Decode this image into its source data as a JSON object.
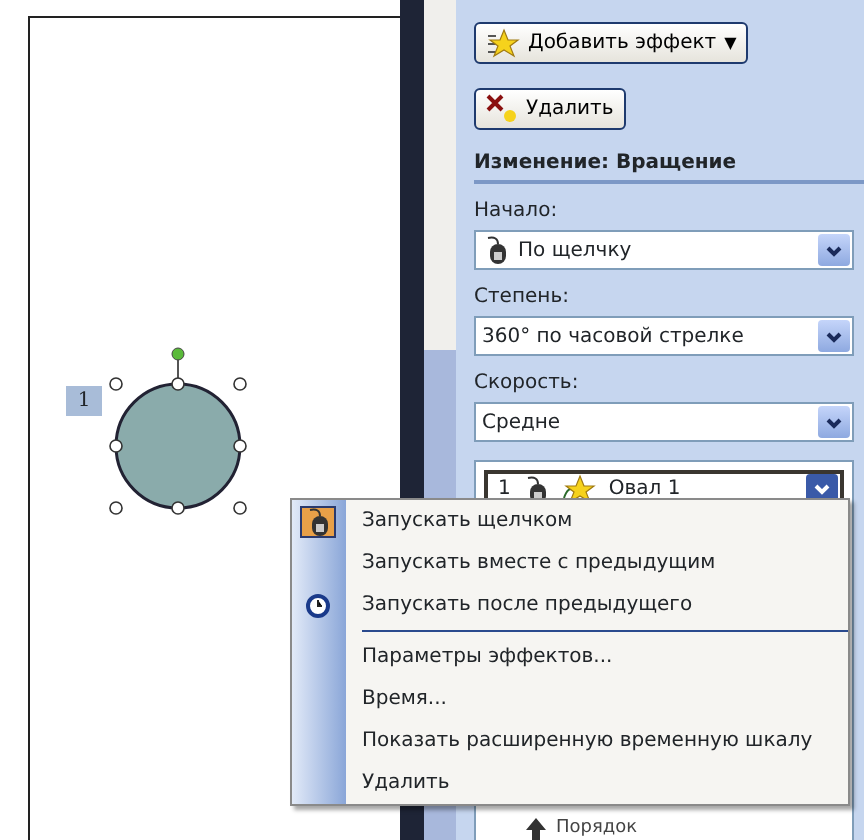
{
  "slide": {
    "shape": {
      "tag": "1",
      "selected": true
    }
  },
  "task_pane": {
    "add_effect_button": {
      "label": "Добавить эффект",
      "arrow": "▼"
    },
    "remove_button": {
      "label": "Удалить"
    },
    "heading": "Изменение: Вращение",
    "fields": [
      {
        "label": "Начало:",
        "value": "По щелчку",
        "kind": "icon"
      },
      {
        "label": "Степень:",
        "value": "360° по часовой стрелке",
        "kind": "plain"
      },
      {
        "label": "Скорость:",
        "value": "Средне",
        "kind": "plain"
      }
    ],
    "effects": [
      {
        "number": "1",
        "name": "Овал 1",
        "selected": true
      }
    ],
    "reorder": {
      "label": "Порядок"
    }
  },
  "context_menu": {
    "items": [
      {
        "label": "Запускать щелчком",
        "kind": "option",
        "checked": true
      },
      {
        "label": "Запускать вместе с предыдущим",
        "kind": "option",
        "checked": false
      },
      {
        "label": "Запускать после предыдущего",
        "kind": "option",
        "checked": false
      },
      {
        "kind": "separator"
      },
      {
        "label": "Параметры эффектов...",
        "kind": "command"
      },
      {
        "label": "Время...",
        "kind": "command"
      },
      {
        "label": "Показать расширенную временную шкалу",
        "kind": "command"
      },
      {
        "label": "Удалить",
        "kind": "command"
      }
    ]
  }
}
